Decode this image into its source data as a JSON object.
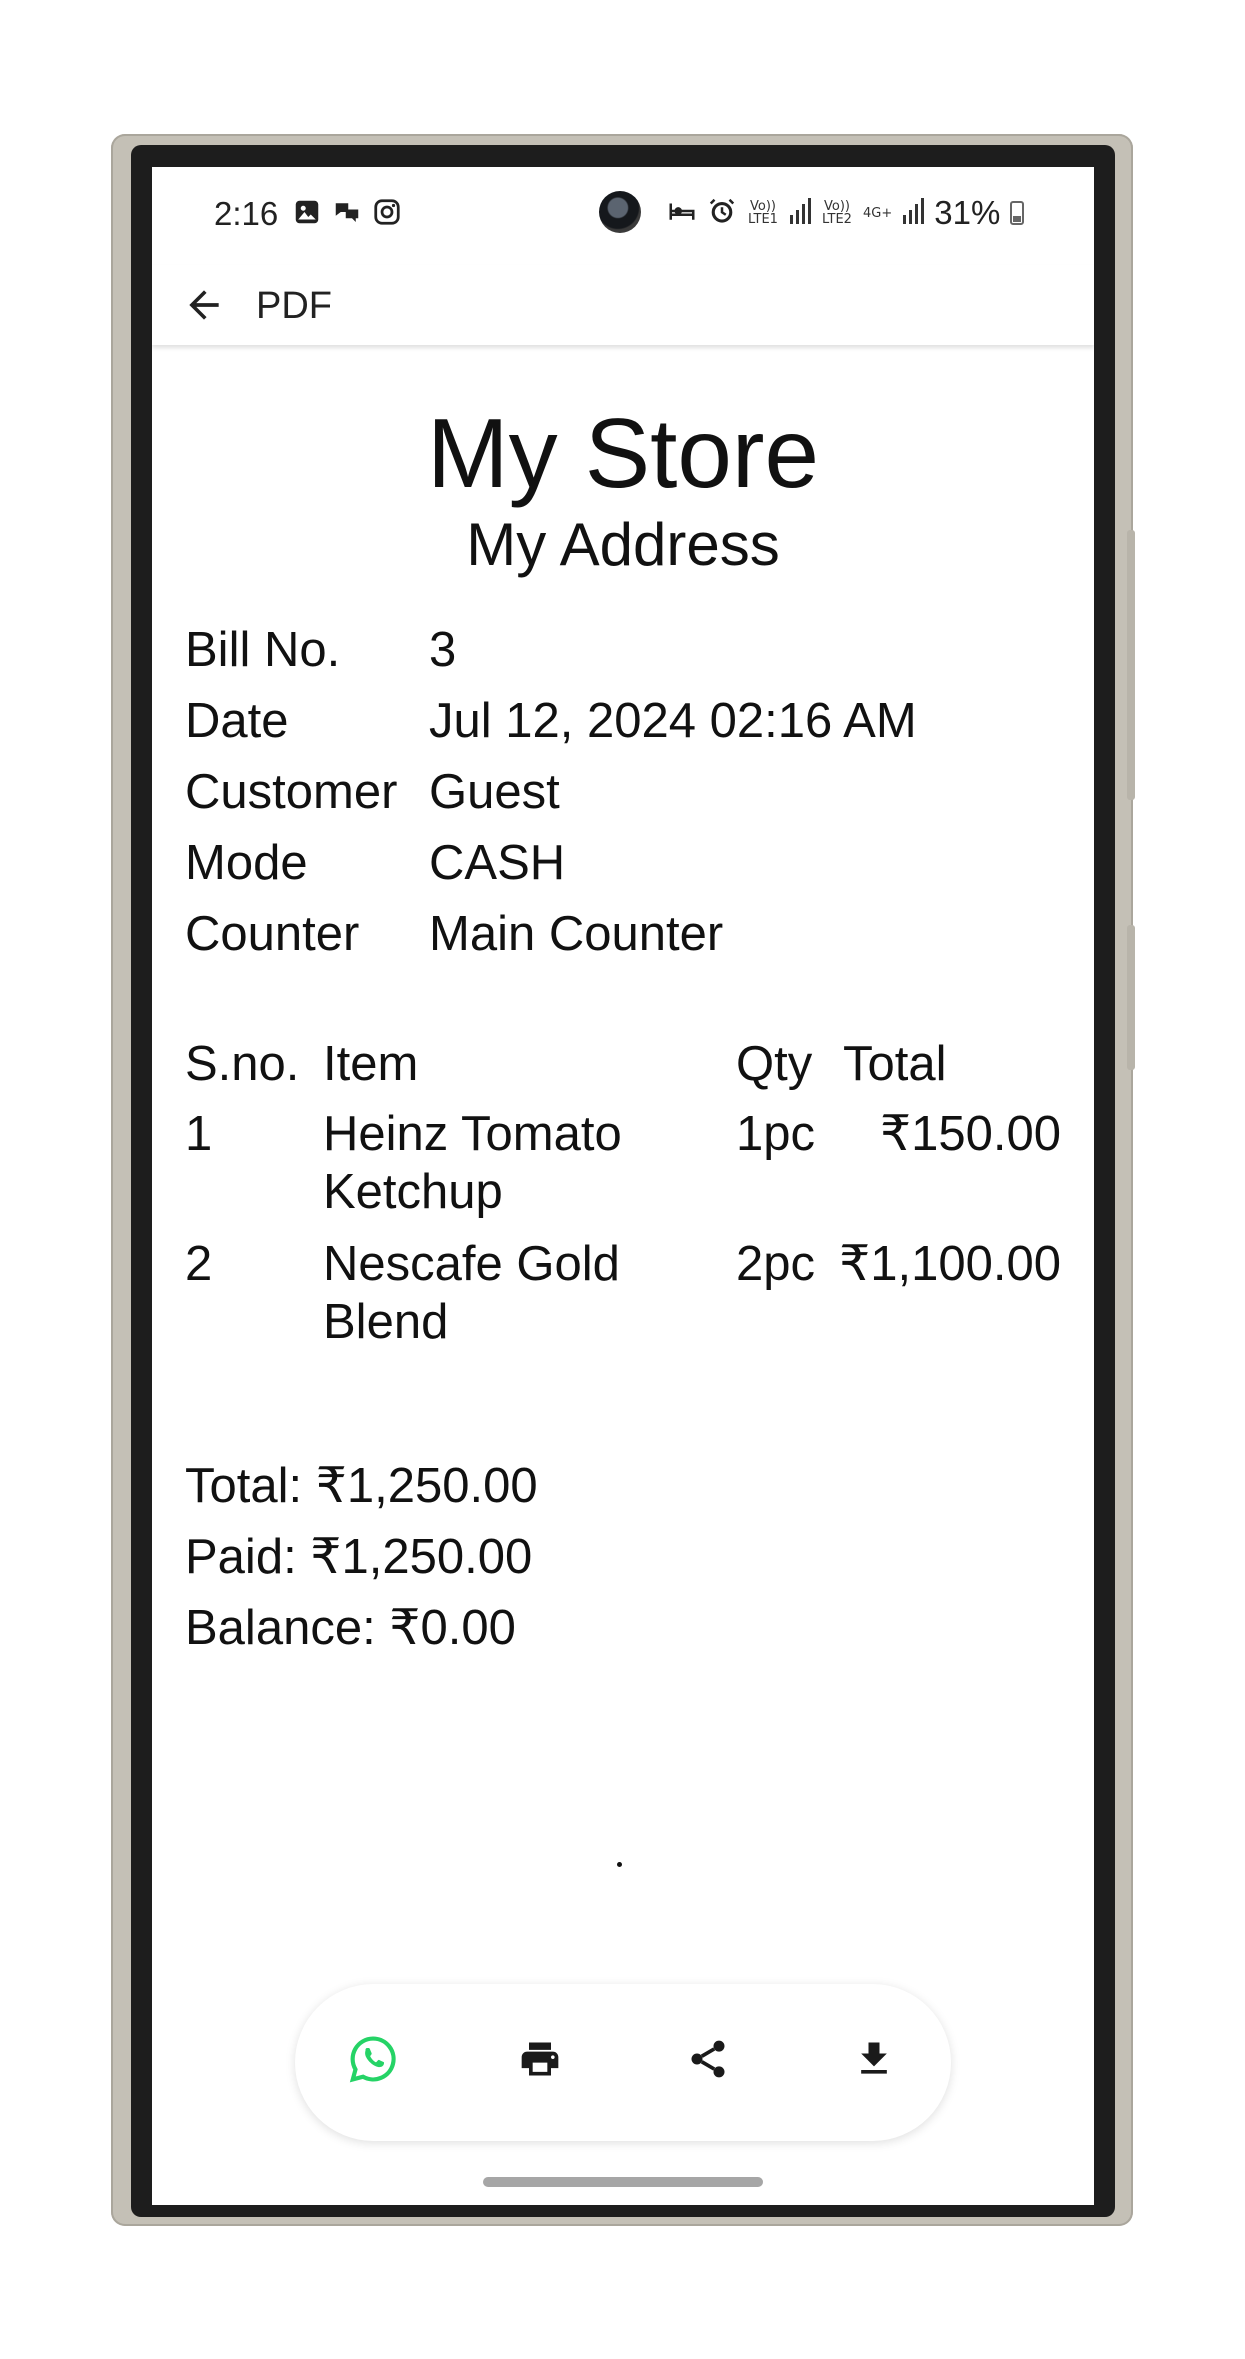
{
  "status_bar": {
    "time": "2:16",
    "battery": "31%",
    "icons": [
      "gallery-icon",
      "chat-icon",
      "instagram-icon",
      "sleep-mode-icon",
      "alarm-icon",
      "volte-lte1-signal-icon",
      "volte-lte2-signal-icon",
      "4g-plus-data-icon",
      "signal-icon",
      "battery-icon"
    ],
    "lte1": "Vo)) LTE1",
    "lte2": "Vo)) LTE2",
    "net": "4G+"
  },
  "app_bar": {
    "title": "PDF",
    "back_icon": "arrow-left-icon"
  },
  "receipt": {
    "store_name": "My Store",
    "address": "My Address",
    "info": [
      {
        "label": "Bill No.",
        "value": "3"
      },
      {
        "label": "Date",
        "value": "Jul 12, 2024 02:16 AM"
      },
      {
        "label": "Customer",
        "value": "Guest"
      },
      {
        "label": "Mode",
        "value": "CASH"
      },
      {
        "label": "Counter",
        "value": "Main Counter"
      }
    ],
    "table": {
      "headers": {
        "sno": "S.no.",
        "item": "Item",
        "qty": "Qty",
        "total": "Total"
      },
      "rows": [
        {
          "sno": "1",
          "item_line1": "Heinz Tomato",
          "item_line2": "Ketchup",
          "qty": "1pc",
          "total": "₹150.00"
        },
        {
          "sno": "2",
          "item_line1": "Nescafe Gold",
          "item_line2": "Blend",
          "qty": "2pc",
          "total": "₹1,100.00"
        }
      ]
    },
    "summary": {
      "total": "Total: ₹1,250.00",
      "paid": "Paid: ₹1,250.00",
      "balance": "Balance: ₹0.00"
    }
  },
  "actions": [
    {
      "name": "whatsapp-button",
      "icon": "whatsapp-icon",
      "color": "#25D366"
    },
    {
      "name": "print-button",
      "icon": "printer-icon",
      "color": "#1a1a1a"
    },
    {
      "name": "share-button",
      "icon": "share-icon",
      "color": "#1a1a1a"
    },
    {
      "name": "download-button",
      "icon": "download-icon",
      "color": "#1a1a1a"
    }
  ]
}
